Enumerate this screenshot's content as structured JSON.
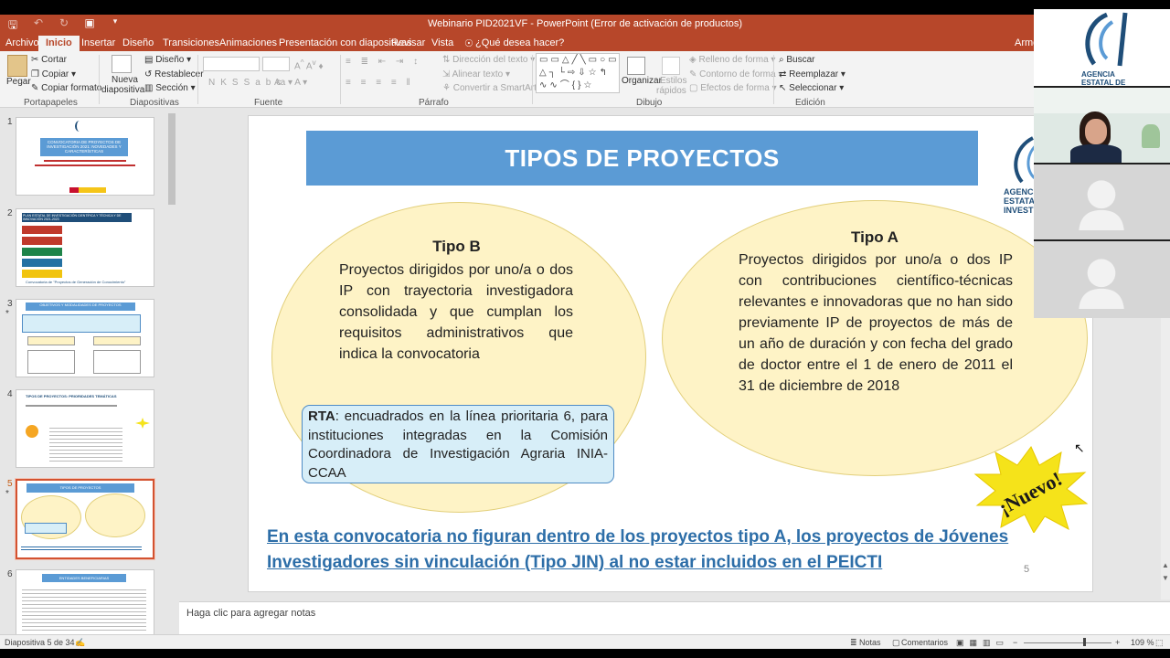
{
  "window": {
    "title": "Webinario PID2021VF - PowerPoint (Error de activación de productos)"
  },
  "qat": {
    "save_icon": "save-icon",
    "undo_icon": "undo-icon",
    "redo_icon": "redo-icon",
    "present_icon": "present-icon"
  },
  "tabs": [
    {
      "label": "Archivo"
    },
    {
      "label": "Inicio"
    },
    {
      "label": "Insertar"
    },
    {
      "label": "Diseño"
    },
    {
      "label": "Transiciones"
    },
    {
      "label": "Animaciones"
    },
    {
      "label": "Presentación con diapositivas"
    },
    {
      "label": "Revisar"
    },
    {
      "label": "Vista"
    },
    {
      "label": "¿Qué desea hacer?"
    },
    {
      "label": "Armes"
    }
  ],
  "ribbon": {
    "clipboard": {
      "paste": "Pegar",
      "cut": "Cortar",
      "copy": "Copiar",
      "copy_format": "Copiar formato",
      "group": "Portapapeles"
    },
    "slides": {
      "new_slide": "Nueva",
      "new_slide2": "diapositiva",
      "layout": "Diseño",
      "reset": "Restablecer",
      "section": "Sección",
      "group": "Diapositivas"
    },
    "font": {
      "group": "Fuente",
      "bold": "N",
      "italic": "K",
      "underline": "S",
      "strike": "S",
      "spacing": "abc"
    },
    "paragraph": {
      "text_direction": "Dirección del texto",
      "align_text": "Alinear texto",
      "smartart": "Convertir a SmartArt",
      "group": "Párrafo"
    },
    "drawing": {
      "arrange": "Organizar",
      "quick_styles": "Estilos",
      "quick_styles2": "rápidos",
      "fill": "Relleno de forma",
      "outline": "Contorno de forma",
      "effects": "Efectos de forma",
      "group": "Dibujo"
    },
    "editing": {
      "find": "Buscar",
      "replace": "Reemplazar",
      "select": "Seleccionar",
      "group": "Edición"
    }
  },
  "thumbnails": [
    {
      "num": "1",
      "title": "CONVOCATORIA DE PROYECTOS DE INVESTIGACIÓN 2021: NOVEDADES Y CARACTERÍSTICAS"
    },
    {
      "num": "2",
      "title": "PLAN ESTATAL DE INVESTIGACIÓN CIENTÍFICA Y TÉCNICA Y DE INNOVACIÓN 2021-2023",
      "caption": "Convocatoria de \"Proyectos de Generación de Conocimiento\""
    },
    {
      "num": "3",
      "title": "OBJETIVOS Y MODALIDADES DE PROYECTOS"
    },
    {
      "num": "4",
      "title": "TIPOS DE PROYECTOS: PRIORIDADES TEMÁTICAS"
    },
    {
      "num": "5",
      "title": "TIPOS DE PROYECTOS"
    },
    {
      "num": "6",
      "title": "ENTIDADES BENEFICIARIAS"
    }
  ],
  "slide": {
    "title": "TIPOS DE PROYECTOS",
    "tipo_b": {
      "title": "Tipo B",
      "text": "Proyectos dirigidos por uno/a o dos IP con trayectoria investigadora consolidada y que cumplan los requisitos administrativos que indica la convocatoria"
    },
    "tipo_a": {
      "title": "Tipo A",
      "text": "Proyectos dirigidos por uno/a o dos IP con contribuciones científico-técnicas relevantes e innovadoras que no han sido previamente IP de proyectos de más de un año de duración y con fecha del grado de doctor entre el 1 de enero de 2011  el 31 de diciembre de 2018"
    },
    "rta": {
      "label": "RTA",
      "text": ": encuadrados en la línea prioritaria 6, para instituciones integradas en la Comisión Coordinadora de Investigación Agraria INIA-CCAA"
    },
    "footer": "En esta convocatoria no figuran dentro de los proyectos tipo A, los proyectos de Jóvenes Investigadores sin vinculación (Tipo JIN) al no estar incluidos en el PEICTI",
    "page": "5",
    "logo": {
      "line1": "AGENCIA",
      "line2": "ESTATAL D",
      "line3": "INVESTIGA"
    },
    "nuevo": "¡Nuevo!"
  },
  "notes": {
    "placeholder": "Haga clic para agregar notas"
  },
  "status": {
    "slide_count": "Diapositiva 5 de 34",
    "notes": "Notas",
    "comments": "Comentarios",
    "zoom": "109 %"
  },
  "video": {
    "logo": {
      "line1": "AGENCIA",
      "line2": "ESTATAL DE"
    }
  }
}
